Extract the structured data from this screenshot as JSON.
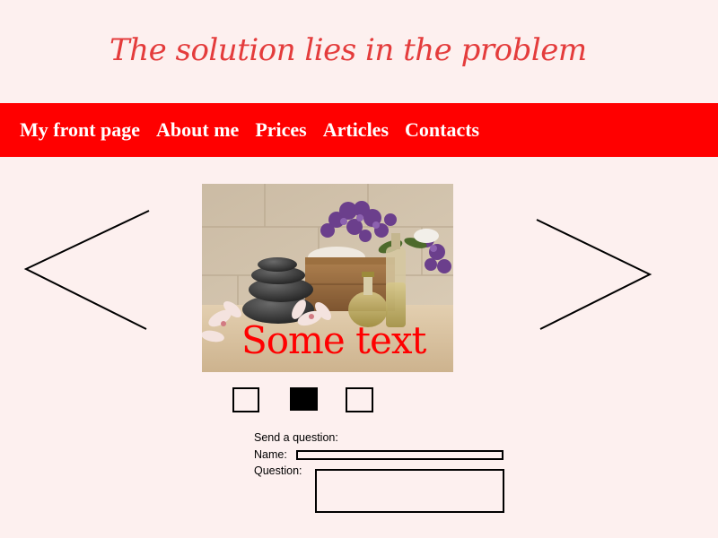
{
  "header": {
    "title": "The solution lies in the problem"
  },
  "nav": {
    "items": [
      {
        "label": "My front page"
      },
      {
        "label": "About me"
      },
      {
        "label": "Prices"
      },
      {
        "label": "Articles"
      },
      {
        "label": "Contacts"
      }
    ]
  },
  "slider": {
    "prev_icon": "chevron-left-icon",
    "next_icon": "chevron-right-icon",
    "caption": "Some text",
    "image_subject": "spa-stones-and-lilac-image",
    "indicators": [
      {
        "active": false
      },
      {
        "active": true
      },
      {
        "active": false
      }
    ]
  },
  "form": {
    "heading": "Send a question:",
    "name_label": "Name:",
    "name_value": "",
    "question_label": "Question:",
    "question_value": ""
  },
  "colors": {
    "page_background": "#fdf0ef",
    "nav_background": "#ff0000",
    "title_color": "#e43c3c",
    "caption_color": "#ff0000"
  }
}
